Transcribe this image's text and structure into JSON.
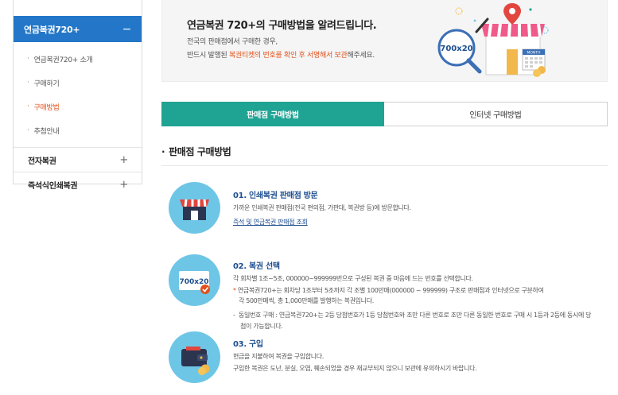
{
  "sidebar": {
    "active_label": "연금복권720+",
    "active_toggle": "−",
    "subitems": [
      {
        "label": "연금복권720+ 소개"
      },
      {
        "label": "구매하기"
      },
      {
        "label": "구매방법"
      },
      {
        "label": "추첨안내"
      }
    ],
    "items": [
      {
        "label": "전자복권",
        "toggle": "+"
      },
      {
        "label": "즉석식인쇄복권",
        "toggle": "+"
      }
    ],
    "bullet": "·"
  },
  "banner": {
    "title": "연금복권 720+의 구매방법을 알려드립니다.",
    "desc1": "전국의 판매점에서 구매한 경우,",
    "desc2_pre": "반드시 발행된 ",
    "desc2_highlight": "복권티켓의 번호를 확인 후 서명해서 보관",
    "desc2_post": "해주세요.",
    "ticket_text": "700x20",
    "calendar_text": "MONTH"
  },
  "tabs": [
    {
      "label": "판매점 구매방법",
      "active": true
    },
    {
      "label": "인터넷 구매방법",
      "active": false
    }
  ],
  "section": {
    "bullet": "·",
    "title": "판매점 구매방법"
  },
  "steps": [
    {
      "title": "01. 인쇄복권 판매점 방문",
      "text": "가까운 인쇄복권 판매점(전국 편의점, 가판대, 복권방 등)에 방문합니다.",
      "link": "즉석 및 연금복권 판매점 조회"
    },
    {
      "title": "02. 복권 선택",
      "ticket_text": "700x20",
      "text1": "각 회차별 1조~5조, 000000~999999번으로 구성된 복권 중 마음에 드는 번호를 선택합니다.",
      "note_mark": "*",
      "text2": "연금복권720+는 회차당 1조부터 5조까지 각 조별 100만매(000000 ~ 999999) 구조로 판매점과 인터넷으로 구분하여",
      "text3": "각 500만매씩, 총 1,000만매를 발행하는 복권입니다.",
      "note_dash": "-",
      "text4": "동일번호 구매 : 연금복권720+는 2등 당첨번호가 1등 당첨번호와 조만 다른 번호로 조만 다른 동일한 번호로 구매 시 1등과 2등에 동시에 당",
      "text5": "첨이 가능합니다."
    },
    {
      "title": "03. 구입",
      "text1": "현금을 지불하여 복권을 구입합니다.",
      "text2": "구입한 복권은 도난, 분실, 오염, 훼손되었을 경우 재교부되지 않으니 보관에 유의하시기 바랍니다."
    }
  ],
  "colors": {
    "sidebar_active": "#2477c8",
    "tab_active": "#1fa393",
    "highlight": "#e2511a",
    "step_title": "#1d4e8f",
    "icon_circle": "#6ec6e6"
  }
}
